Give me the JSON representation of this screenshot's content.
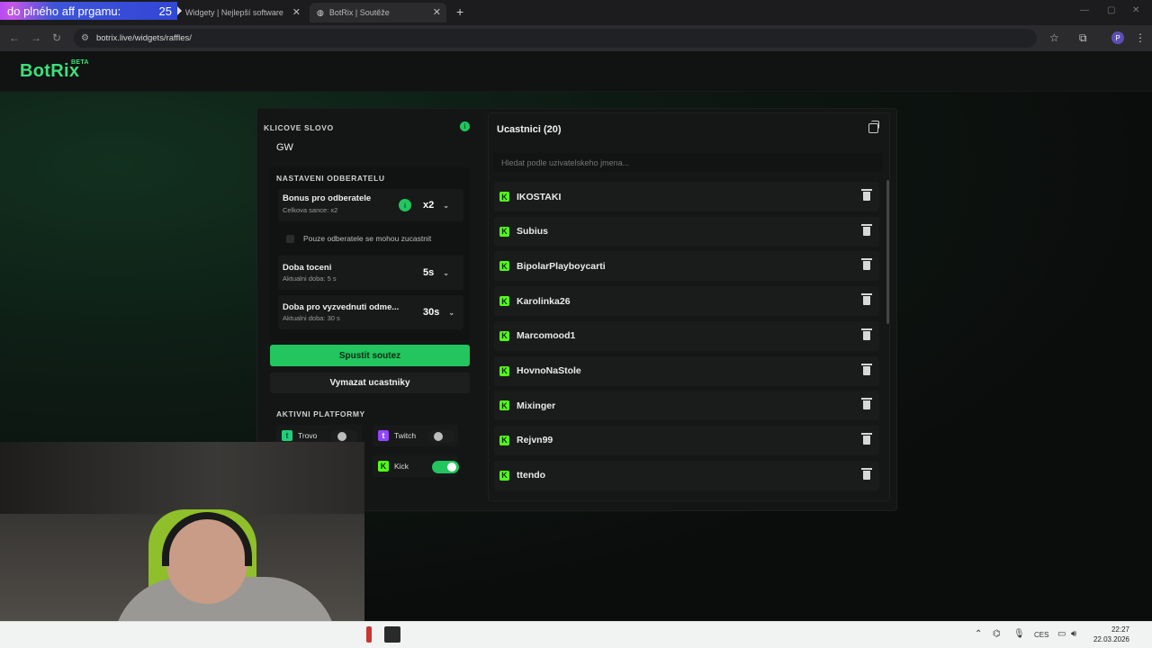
{
  "browser": {
    "overlay": {
      "text": "do plného aff prgamu:",
      "count": "25"
    },
    "tabs": [
      {
        "label": "Widgety | Nejlepší software pro"
      },
      {
        "label": "BotRix | Soutěže"
      }
    ],
    "new_tab": "+",
    "url": "botrix.live/widgets/raffles/",
    "profile_initial": "P"
  },
  "app": {
    "logo": "BotRix",
    "logo_badge": "BETA"
  },
  "raffle": {
    "keyword_title": "KLICOVE SLOVO",
    "keyword_value": "GW",
    "subs_section_title": "NASTAVENI ODBERATELU",
    "subs_bonus": {
      "title": "Bonus pro odberatele",
      "sub": "Celkova sance: x2",
      "value": "x2"
    },
    "subs_only_label": "Pouze odberatele se mohou zucastnit",
    "spin_time": {
      "title": "Doba toceni",
      "sub": "Aktualni doba: 5 s",
      "value": "5s"
    },
    "claim_time": {
      "title": "Doba pro vyzvednuti odme...",
      "sub": "Aktualni doba: 30 s",
      "value": "30s"
    },
    "start_button": "Spustit soutez",
    "clear_button": "Vymazat ucastniky",
    "platforms_title": "AKTIVNI PLATFORMY",
    "platforms": [
      {
        "name": "Trovo",
        "enabled": false
      },
      {
        "name": "Twitch",
        "enabled": false
      },
      {
        "name": "Kick",
        "enabled": true
      }
    ]
  },
  "participants": {
    "title": "Ucastnici (20)",
    "search_placeholder": "Hledat podle uzivatelskeho jmena...",
    "items": [
      "IKOSTAKI",
      "Subius",
      "BipolarPlayboycarti",
      "Karolinka26",
      "Marcomood1",
      "HovnoNaStole",
      "Mixinger",
      "Rejvn99",
      "ttendo"
    ]
  },
  "taskbar": {
    "lang": "CES",
    "time": "22:27",
    "date": "22.03.2026"
  },
  "colors": {
    "accent": "#22c55e",
    "kick": "#53fc18",
    "bg": "#0b0d0c"
  }
}
